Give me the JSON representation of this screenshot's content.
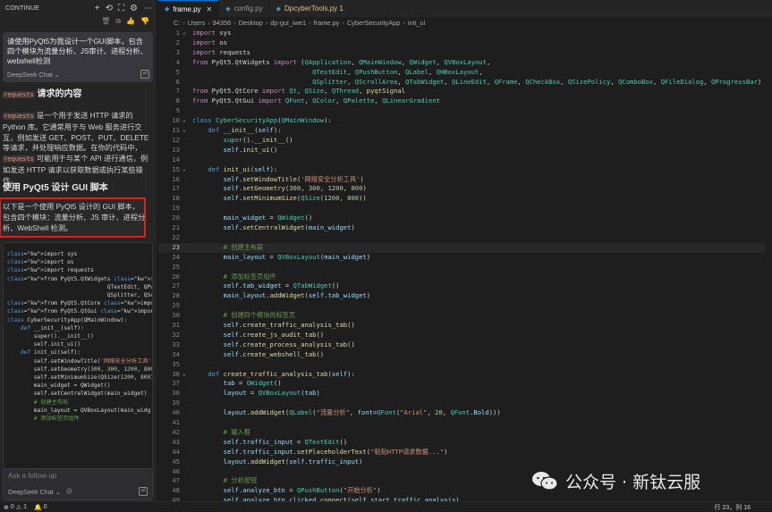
{
  "chat_panel": {
    "title": "CONTINUE",
    "prompt": "请使用PyQt5为我设计一个GUI脚本，包含四个模块为流量分析、JS审计、进程分析、webshell检测",
    "model": "DeepSeek Chat",
    "response": {
      "h_requests_code": "requests",
      "h_requests_text": " 请求的内容",
      "p1_code": "requests",
      "p1_text": " 是一个用于发送 HTTP 请求的 Python 库。它通常用于与 Web 服务进行交互，例如发送 GET、POST、PUT、DELETE 等请求，并处理响应数据。在你的代码中，",
      "p2_code": "requests",
      "p2_text": " 可能用于与某个 API 进行通信，例如发送 HTTP 请求以获取数据或执行某些操作。",
      "h_pyqt": "使用 PyQt5 设计 GUI 脚本",
      "highlight_text": "以下是一个使用 PyQt5 设计的 GUI 脚本，包含四个模块：流量分析、JS 审计、进程分析、WebShell 检测。",
      "code_lines": [
        "import sys",
        "import os",
        "import requests",
        "from PyQt5.QtWidgets import (QApplication, QMa",
        "                              QTextEdit, QPu",
        "                              QSplitter, QSc",
        "from PyQt5.QtCore import Qt, QSize, QThread,",
        "from PyQt5.QtGui import QFont, QColor, QPalet",
        "",
        "class CyberSecurityApp(QMainWindow):",
        "    def __init__(self):",
        "        super().__init__()",
        "        self.init_ui()",
        "",
        "    def init_ui(self):",
        "        self.setWindowTitle('网络安全分析工具')",
        "        self.setGeometry(300, 300, 1200, 800)",
        "        self.setMinimumSize(QSize(1200, 800))",
        "",
        "        main_widget = QWidget()",
        "        self.setCentralWidget(main_widget)",
        "",
        "        # 创建主布局",
        "        main_layout = QVBoxLayout(main_widg",
        "",
        "        # 添加标签页组件"
      ]
    },
    "followup_placeholder": "Ask a follow-up",
    "followup_model": "DeepSeek Chat",
    "at_symbol": "@"
  },
  "editor": {
    "tabs": [
      {
        "label": "frame.py",
        "active": true,
        "modified": false,
        "close": "✕"
      },
      {
        "label": "config.py",
        "active": false,
        "modified": false
      },
      {
        "label": "DpcyberTools.py 1",
        "active": false,
        "modified": true
      }
    ],
    "breadcrumbs": [
      "C:",
      "Users",
      "94356",
      "Desktop",
      "dp-gui_iwe1",
      "frame.py",
      "CyberSecurityApp",
      "init_ui"
    ],
    "current_line": 23,
    "lines": [
      {
        "n": 1,
        "fold": "⌄",
        "code": "<span class='kw'>import</span> sys"
      },
      {
        "n": 2,
        "code": "<span class='kw'>import</span> os"
      },
      {
        "n": 3,
        "code": "<span class='kw'>import</span> requests"
      },
      {
        "n": 4,
        "code": "<span class='kw'>from</span> PyQt5.QtWidgets <span class='kw'>import</span> (<span class='cl'>QApplication</span>, <span class='cl'>QMainWindow</span>, <span class='cl'>QWidget</span>, <span class='cl'>QVBoxLayout</span>,"
      },
      {
        "n": 5,
        "code": "                               <span class='cl'>QTextEdit</span>, <span class='cl'>QPushButton</span>, <span class='cl'>QLabel</span>, <span class='cl'>QHBoxLayout</span>,"
      },
      {
        "n": 6,
        "code": "                               <span class='cl'>QSplitter</span>, <span class='cl'>QScrollArea</span>, <span class='cl'>QTabWidget</span>, <span class='cl'>QLineEdit</span>, <span class='cl'>QFrame</span>, <span class='cl'>QCheckBox</span>, <span class='cl'>QSizePolicy</span>, <span class='cl'>QComboBox</span>, <span class='cl'>QFileDialog</span>, <span class='cl'>QProgressBar</span>)"
      },
      {
        "n": 7,
        "code": "<span class='kw'>from</span> PyQt5.QtCore <span class='kw'>import</span> <span class='cl'>Qt</span>, <span class='cl'>QSize</span>, <span class='cl'>QThread</span>, <span class='fn'>pyqtSignal</span>"
      },
      {
        "n": 8,
        "code": "<span class='kw'>from</span> PyQt5.QtGui <span class='kw'>import</span> <span class='cl'>QFont</span>, <span class='cl'>QColor</span>, <span class='cl'>QPalette</span>, <span class='cl'>QLinearGradient</span>"
      },
      {
        "n": 9,
        "code": ""
      },
      {
        "n": 10,
        "fold": "⌄",
        "code": "<span class='kd'>class</span> <span class='cl'>CyberSecurityApp</span>(<span class='cl'>QMainWindow</span>):"
      },
      {
        "n": 11,
        "fold": "⌄",
        "code": "    <span class='kd'>def</span> <span class='fn'>__init__</span>(<span class='va'>self</span>):"
      },
      {
        "n": 12,
        "code": "        <span class='cl'>super</span>().<span class='fn'>__init__</span>()"
      },
      {
        "n": 13,
        "code": "        <span class='va'>self</span>.<span class='fn'>init_ui</span>()"
      },
      {
        "n": 14,
        "code": ""
      },
      {
        "n": 15,
        "fold": "⌄",
        "code": "    <span class='kd'>def</span> <span class='fn'>init_ui</span>(<span class='va'>self</span>):"
      },
      {
        "n": 16,
        "code": "        <span class='va'>self</span>.<span class='fn'>setWindowTitle</span>(<span class='st'>'网络安全分析工具'</span>)"
      },
      {
        "n": 17,
        "code": "        <span class='va'>self</span>.<span class='fn'>setGeometry</span>(<span class='nu'>300</span>, <span class='nu'>300</span>, <span class='nu'>1200</span>, <span class='nu'>800</span>)"
      },
      {
        "n": 18,
        "code": "        <span class='va'>self</span>.<span class='fn'>setMinimumSize</span>(<span class='cl'>QSize</span>(<span class='nu'>1200</span>, <span class='nu'>800</span>))"
      },
      {
        "n": 19,
        "code": ""
      },
      {
        "n": 20,
        "code": "        <span class='va'>main_widget</span> = <span class='cl'>QWidget</span>()"
      },
      {
        "n": 21,
        "code": "        <span class='va'>self</span>.<span class='fn'>setCentralWidget</span>(<span class='va'>main_widget</span>)"
      },
      {
        "n": 22,
        "code": ""
      },
      {
        "n": 23,
        "code": "        <span class='cm'># 创建主布局</span>"
      },
      {
        "n": 24,
        "code": "        <span class='va'>main_layout</span> = <span class='cl'>QVBoxLayout</span>(<span class='va'>main_widget</span>)"
      },
      {
        "n": 25,
        "code": ""
      },
      {
        "n": 26,
        "code": "        <span class='cm'># 添加标签页组件</span>"
      },
      {
        "n": 27,
        "code": "        <span class='va'>self</span>.<span class='va'>tab_widget</span> = <span class='cl'>QTabWidget</span>()"
      },
      {
        "n": 28,
        "code": "        <span class='va'>main_layout</span>.<span class='fn'>addWidget</span>(<span class='va'>self</span>.<span class='va'>tab_widget</span>)"
      },
      {
        "n": 29,
        "code": ""
      },
      {
        "n": 30,
        "code": "        <span class='cm'># 创建四个模块的标签页</span>"
      },
      {
        "n": 31,
        "code": "        <span class='va'>self</span>.<span class='fn'>create_traffic_analysis_tab</span>()"
      },
      {
        "n": 32,
        "code": "        <span class='va'>self</span>.<span class='fn'>create_js_audit_tab</span>()"
      },
      {
        "n": 33,
        "code": "        <span class='va'>self</span>.<span class='fn'>create_process_analysis_tab</span>()"
      },
      {
        "n": 34,
        "code": "        <span class='va'>self</span>.<span class='fn'>create_webshell_tab</span>()"
      },
      {
        "n": 35,
        "code": ""
      },
      {
        "n": 36,
        "fold": "⌄",
        "code": "    <span class='kd'>def</span> <span class='fn'>create_traffic_analysis_tab</span>(<span class='va'>self</span>):"
      },
      {
        "n": 37,
        "code": "        <span class='va'>tab</span> = <span class='cl'>QWidget</span>()"
      },
      {
        "n": 38,
        "code": "        <span class='va'>layout</span> = <span class='cl'>QVBoxLayout</span>(<span class='va'>tab</span>)"
      },
      {
        "n": 39,
        "code": ""
      },
      {
        "n": 40,
        "code": "        <span class='va'>layout</span>.<span class='fn'>addWidget</span>(<span class='cl'>QLabel</span>(<span class='st'>\"流量分析\"</span>, <span class='va'>font</span>=<span class='cl'>QFont</span>(<span class='st'>\"Arial\"</span>, <span class='nu'>20</span>, <span class='cl'>QFont</span>.<span class='va'>Bold</span>)))"
      },
      {
        "n": 41,
        "code": ""
      },
      {
        "n": 42,
        "code": "        <span class='cm'># 输入框</span>"
      },
      {
        "n": 43,
        "code": "        <span class='va'>self</span>.<span class='va'>traffic_input</span> = <span class='cl'>QTextEdit</span>()"
      },
      {
        "n": 44,
        "code": "        <span class='va'>self</span>.<span class='va'>traffic_input</span>.<span class='fn'>setPlaceholderText</span>(<span class='st'>\"粘贴HTTP请求数据...\"</span>)"
      },
      {
        "n": 45,
        "code": "        <span class='va'>layout</span>.<span class='fn'>addWidget</span>(<span class='va'>self</span>.<span class='va'>traffic_input</span>)"
      },
      {
        "n": 46,
        "code": ""
      },
      {
        "n": 47,
        "code": "        <span class='cm'># 分析按钮</span>"
      },
      {
        "n": 48,
        "code": "        <span class='va'>self</span>.<span class='va'>analyze_btn</span> = <span class='cl'>QPushButton</span>(<span class='st'>\"开始分析\"</span>)"
      },
      {
        "n": 49,
        "code": "        <span class='va'>self</span>.<span class='va'>analyze_btn</span>.<span class='va'>clicked</span>.<span class='fn'>connect</span>(<span class='va'>self</span>.<span class='va'>start_traffic_analysis</span>)"
      }
    ]
  },
  "status_bar": {
    "errors": "0",
    "warnings": "1",
    "info": "0",
    "position": "行 23，列 16"
  },
  "watermark": {
    "text": "公众号 · 新钛云服"
  }
}
